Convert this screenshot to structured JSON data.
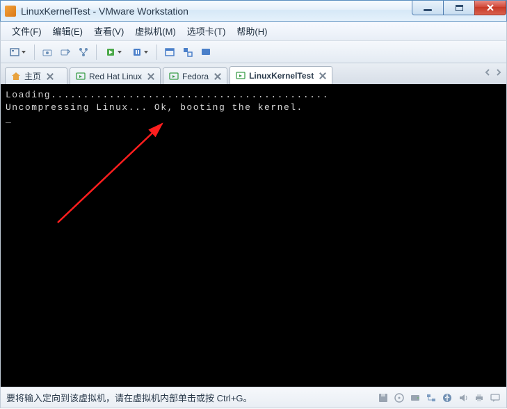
{
  "window": {
    "title": "LinuxKernelTest - VMware Workstation"
  },
  "menu": {
    "file": "文件(F)",
    "edit": "编辑(E)",
    "view": "查看(V)",
    "vm": "虚拟机(M)",
    "tabs": "选项卡(T)",
    "help": "帮助(H)"
  },
  "tabs": {
    "home": "主页",
    "items": [
      {
        "label": "Red Hat Linux"
      },
      {
        "label": "Fedora"
      },
      {
        "label": "LinuxKernelTest"
      }
    ]
  },
  "console": {
    "line1": "Loading...........................................",
    "line2": "Uncompressing Linux... Ok, booting the kernel.",
    "cursor": "_"
  },
  "status": {
    "text": "要将输入定向到该虚拟机，请在虚拟机内部单击或按 Ctrl+G。"
  }
}
